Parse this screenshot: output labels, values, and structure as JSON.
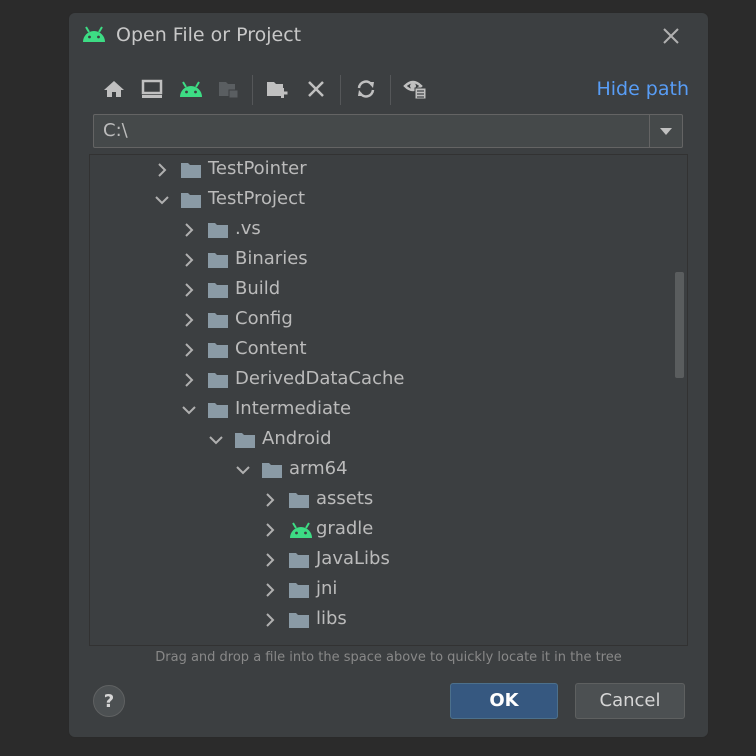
{
  "dialog": {
    "title": "Open File or Project",
    "hide_path_label": "Hide path",
    "path_value": "C:\\",
    "hint": "Drag and drop a file into the space above to quickly locate it in the tree",
    "help_label": "?",
    "ok_label": "OK",
    "cancel_label": "Cancel"
  },
  "colors": {
    "background": "#3c3f41",
    "accent_link": "#589df6",
    "ok_button": "#365880",
    "android_green": "#3ddc84",
    "folder": "#8a9aa5"
  },
  "toolbar": [
    {
      "name": "home-icon"
    },
    {
      "name": "desktop-icon"
    },
    {
      "name": "android-project-icon"
    },
    {
      "name": "project-folder-icon"
    },
    {
      "name": "new-folder-icon"
    },
    {
      "name": "delete-icon"
    },
    {
      "name": "refresh-icon"
    },
    {
      "name": "show-hidden-icon"
    }
  ],
  "tree": [
    {
      "label": "TestPointer",
      "depth": 0,
      "expanded": false,
      "icon": "folder"
    },
    {
      "label": "TestProject",
      "depth": 0,
      "expanded": true,
      "icon": "folder"
    },
    {
      "label": ".vs",
      "depth": 1,
      "expanded": false,
      "icon": "folder"
    },
    {
      "label": "Binaries",
      "depth": 1,
      "expanded": false,
      "icon": "folder"
    },
    {
      "label": "Build",
      "depth": 1,
      "expanded": false,
      "icon": "folder"
    },
    {
      "label": "Config",
      "depth": 1,
      "expanded": false,
      "icon": "folder"
    },
    {
      "label": "Content",
      "depth": 1,
      "expanded": false,
      "icon": "folder"
    },
    {
      "label": "DerivedDataCache",
      "depth": 1,
      "expanded": false,
      "icon": "folder"
    },
    {
      "label": "Intermediate",
      "depth": 1,
      "expanded": true,
      "icon": "folder"
    },
    {
      "label": "Android",
      "depth": 2,
      "expanded": true,
      "icon": "folder"
    },
    {
      "label": "arm64",
      "depth": 3,
      "expanded": true,
      "icon": "folder"
    },
    {
      "label": "assets",
      "depth": 4,
      "expanded": false,
      "icon": "folder"
    },
    {
      "label": "gradle",
      "depth": 4,
      "expanded": false,
      "icon": "android"
    },
    {
      "label": "JavaLibs",
      "depth": 4,
      "expanded": false,
      "icon": "folder"
    },
    {
      "label": "jni",
      "depth": 4,
      "expanded": false,
      "icon": "folder"
    },
    {
      "label": "libs",
      "depth": 4,
      "expanded": false,
      "icon": "folder"
    }
  ]
}
